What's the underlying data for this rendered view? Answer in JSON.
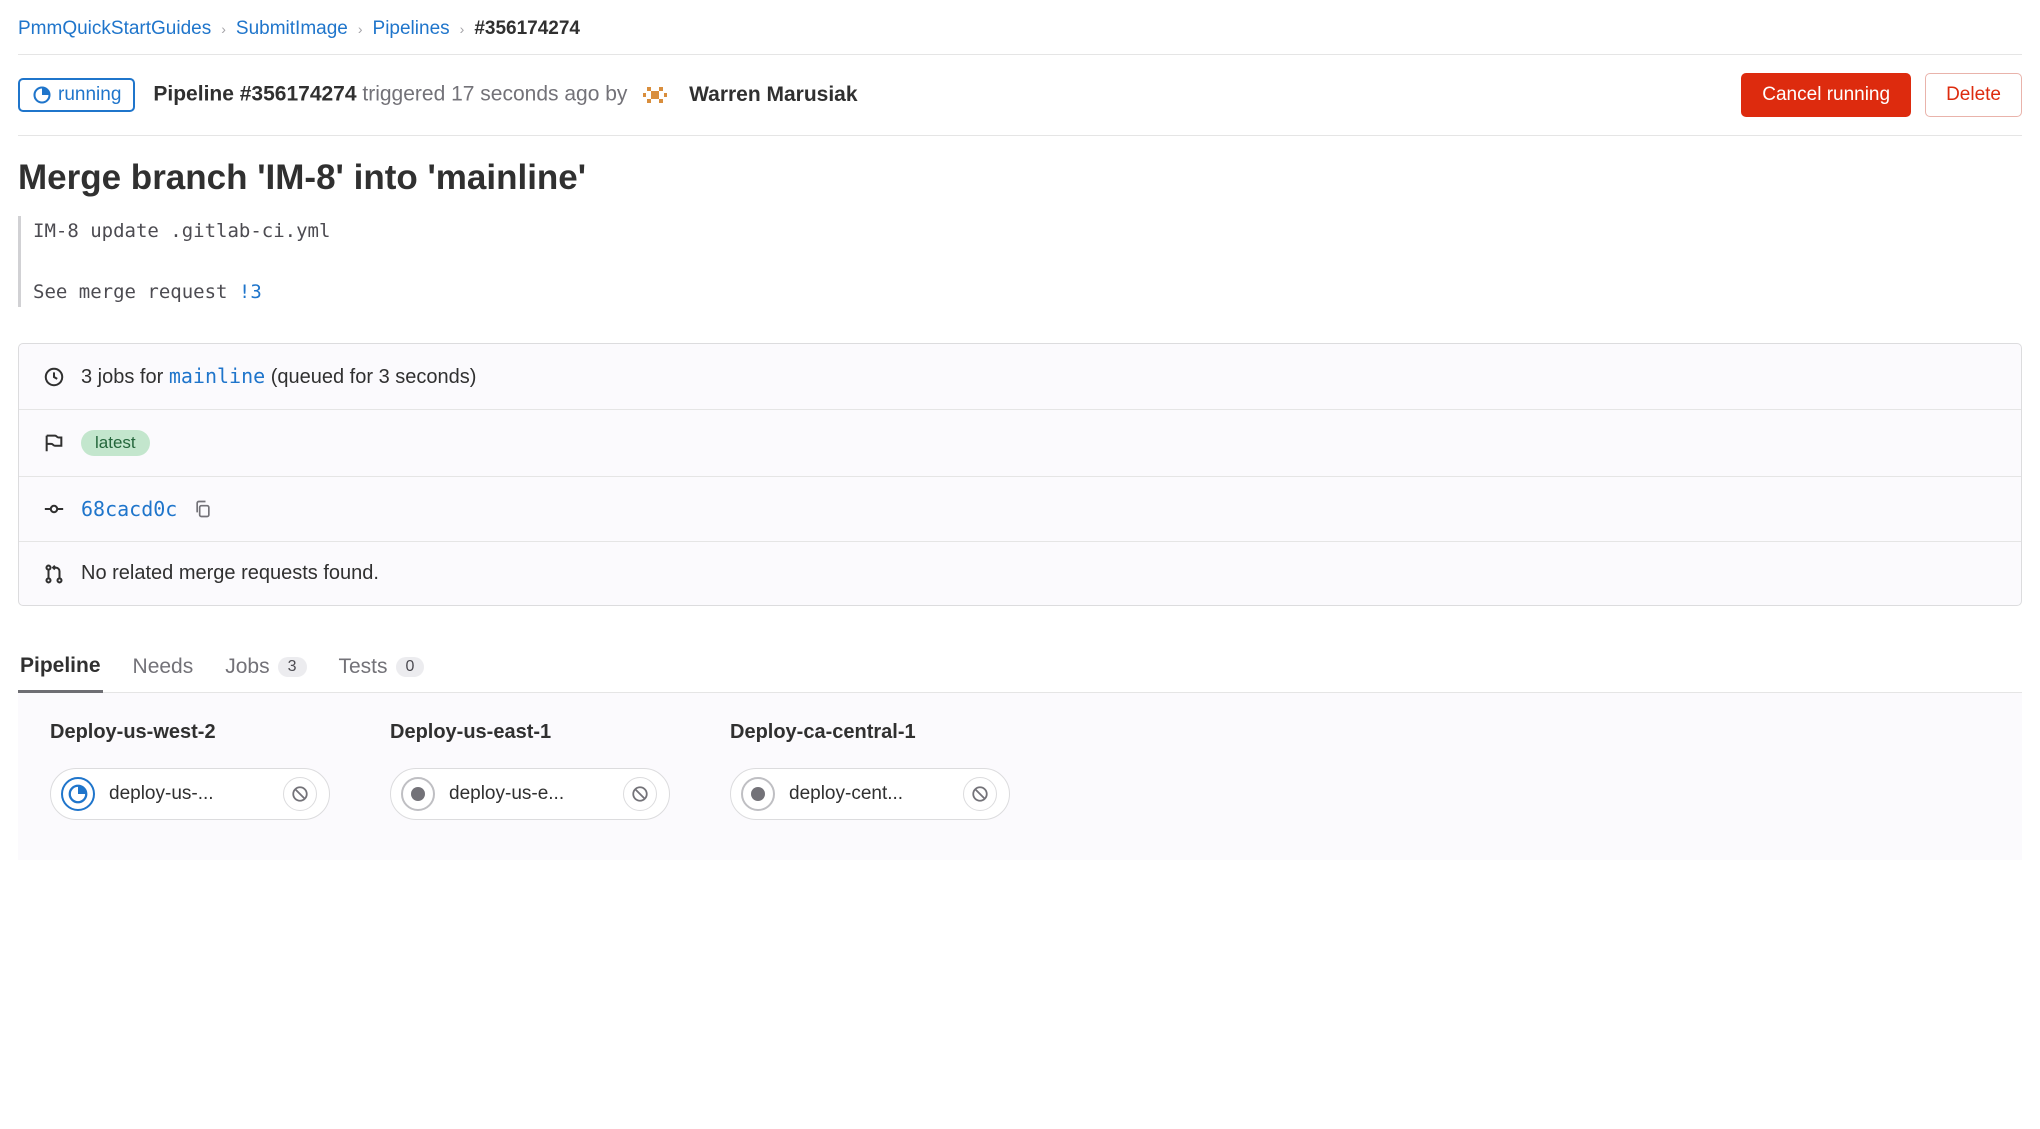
{
  "breadcrumb": {
    "items": [
      "PmmQuickStartGuides",
      "SubmitImage",
      "Pipelines"
    ],
    "current": "#356174274"
  },
  "header": {
    "status_label": "running",
    "pipeline_prefix": "Pipeline ",
    "pipeline_id": "#356174274",
    "triggered_text": " triggered 17 seconds ago by",
    "user_name": "Warren Marusiak",
    "cancel_label": "Cancel running",
    "delete_label": "Delete"
  },
  "title": "Merge branch 'IM-8' into 'mainline'",
  "commit": {
    "line1": "IM-8 update .gitlab-ci.yml",
    "mr_prefix": "See merge request ",
    "mr_link": "!3"
  },
  "info": {
    "jobs_prefix": "3 jobs for ",
    "branch": "mainline",
    "jobs_suffix": " (queued for 3 seconds)",
    "latest_label": "latest",
    "commit_sha": "68cacd0c",
    "no_mr_text": "No related merge requests found."
  },
  "tabs": {
    "pipeline": "Pipeline",
    "needs": "Needs",
    "jobs": "Jobs",
    "jobs_count": "3",
    "tests": "Tests",
    "tests_count": "0"
  },
  "stages": [
    {
      "title": "Deploy-us-west-2",
      "job_name": "deploy-us-...",
      "status": "running"
    },
    {
      "title": "Deploy-us-east-1",
      "job_name": "deploy-us-e...",
      "status": "manual"
    },
    {
      "title": "Deploy-ca-central-1",
      "job_name": "deploy-cent...",
      "status": "manual"
    }
  ]
}
